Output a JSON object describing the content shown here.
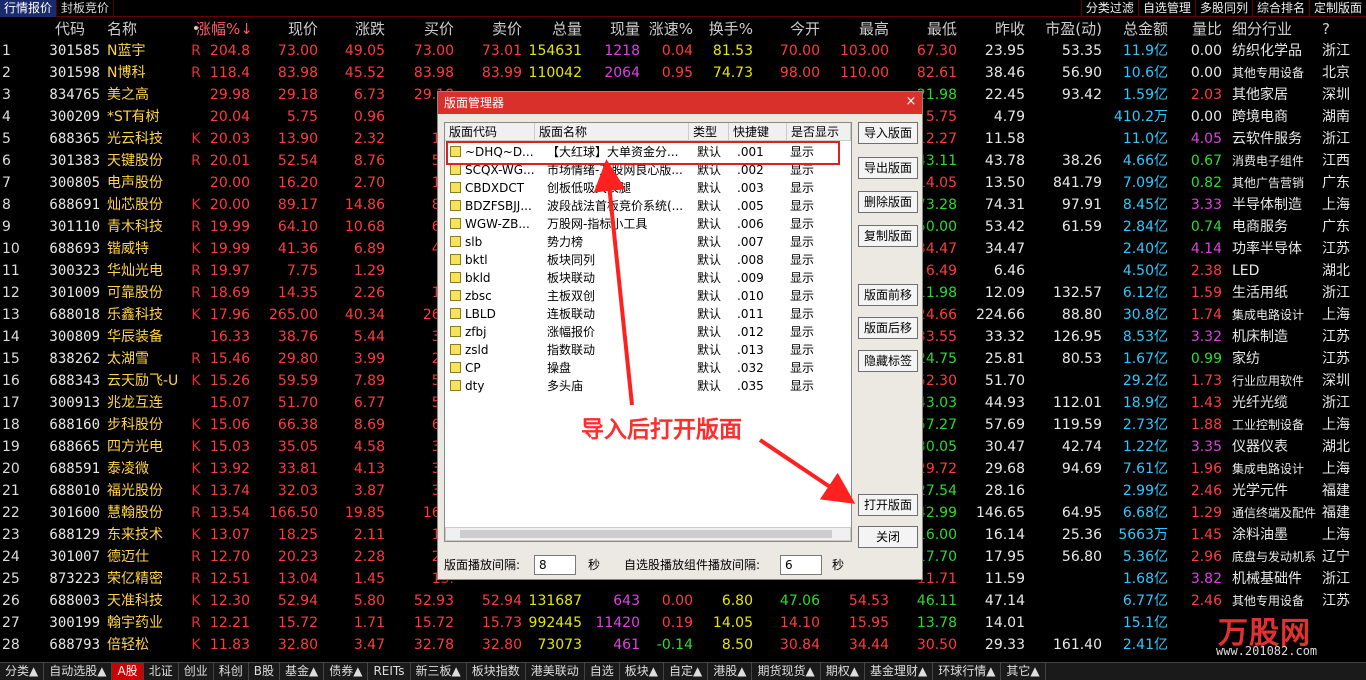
{
  "top_tabs": [
    "行情报价",
    "封板竞价"
  ],
  "top_right": [
    "分类过滤",
    "自选管理",
    "多股同列",
    "综合排名",
    "定制版面"
  ],
  "header": {
    "idx": "",
    "code": "代码",
    "name": "名称",
    "dot": "•",
    "chg": "涨幅%↓",
    "price": "现价",
    "diff": "涨跌",
    "buy": "买价",
    "sell": "卖价",
    "vol": "总量",
    "cur": "现量",
    "spd": "涨速%",
    "turn": "换手%",
    "open": "今开",
    "high": "最高",
    "low": "最低",
    "prev": "昨收",
    "pe": "市盈(动)",
    "amt": "总金额",
    "vr": "量比",
    "ind": "细分行业",
    "reg": "?"
  },
  "rows": [
    {
      "idx": "1",
      "code": "301585",
      "name": "N蓝宇",
      "flag": "R",
      "chg": "204.8",
      "price": "73.00",
      "diff": "49.05",
      "buy": "73.00",
      "sell": "73.01",
      "vol": "154631",
      "cur": "1218",
      "spd": "0.04",
      "turn": "81.53",
      "open": "70.00",
      "high": "103.00",
      "low": "67.30",
      "prev": "23.95",
      "pe": "53.35",
      "amt": "11.9亿",
      "vr": "0.00",
      "ind": "纺织化学品",
      "reg": "浙江"
    },
    {
      "idx": "2",
      "code": "301598",
      "name": "N博科",
      "flag": "R",
      "chg": "118.4",
      "price": "83.98",
      "diff": "45.52",
      "buy": "83.98",
      "sell": "83.99",
      "vol": "110042",
      "cur": "2064",
      "spd": "0.95",
      "turn": "74.73",
      "open": "98.00",
      "high": "110.00",
      "low": "82.61",
      "prev": "38.46",
      "pe": "56.90",
      "amt": "10.6亿",
      "vr": "0.00",
      "ind": "其他专用设备",
      "reg": "北京"
    },
    {
      "idx": "3",
      "code": "834765",
      "name": "美之高",
      "flag": "",
      "chg": "29.98",
      "price": "29.18",
      "diff": "6.73",
      "buy": "29.18",
      "sell": "",
      "vol": "",
      "cur": "",
      "spd": "",
      "turn": "",
      "open": "",
      "high": "",
      "low": "21.98",
      "prev": "22.45",
      "pe": "93.42",
      "amt": "1.59亿",
      "vr": "2.03",
      "ind": "其他家居",
      "reg": "深圳"
    },
    {
      "idx": "4",
      "code": "300209",
      "name": "*ST有树",
      "flag": "",
      "chg": "20.04",
      "price": "5.75",
      "diff": "0.96",
      "buy": "5.",
      "sell": "",
      "vol": "",
      "cur": "",
      "spd": "",
      "turn": "",
      "open": "",
      "high": "",
      "low": "5.75",
      "prev": "4.79",
      "pe": "",
      "amt": "410.2万",
      "vr": "0.00",
      "ind": "跨境电商",
      "reg": "湖南"
    },
    {
      "idx": "5",
      "code": "688365",
      "name": "光云科技",
      "flag": "K",
      "chg": "20.03",
      "price": "13.90",
      "diff": "2.32",
      "buy": "13.",
      "sell": "",
      "vol": "",
      "cur": "",
      "spd": "",
      "turn": "",
      "open": "",
      "high": "",
      "low": "12.27",
      "prev": "11.58",
      "pe": "",
      "amt": "11.0亿",
      "vr": "4.05",
      "ind": "云软件服务",
      "reg": "浙江"
    },
    {
      "idx": "6",
      "code": "301383",
      "name": "天键股份",
      "flag": "R",
      "chg": "20.01",
      "price": "52.54",
      "diff": "8.76",
      "buy": "52.",
      "sell": "",
      "vol": "",
      "cur": "",
      "spd": "",
      "turn": "",
      "open": "",
      "high": "",
      "low": "43.11",
      "prev": "43.78",
      "pe": "38.26",
      "amt": "4.66亿",
      "vr": "0.67",
      "ind": "消费电子组件",
      "reg": "江西"
    },
    {
      "idx": "7",
      "code": "300805",
      "name": "电声股份",
      "flag": "",
      "chg": "20.00",
      "price": "16.20",
      "diff": "2.70",
      "buy": "16.",
      "sell": "",
      "vol": "",
      "cur": "",
      "spd": "",
      "turn": "",
      "open": "",
      "high": "",
      "low": "14.05",
      "prev": "13.50",
      "pe": "841.79",
      "amt": "7.09亿",
      "vr": "0.82",
      "ind": "其他广告营销",
      "reg": "广东"
    },
    {
      "idx": "8",
      "code": "688691",
      "name": "灿芯股份",
      "flag": "K",
      "chg": "20.00",
      "price": "89.17",
      "diff": "14.86",
      "buy": "89.",
      "sell": "",
      "vol": "",
      "cur": "",
      "spd": "",
      "turn": "",
      "open": "",
      "high": "",
      "low": "73.28",
      "prev": "74.31",
      "pe": "97.91",
      "amt": "8.45亿",
      "vr": "3.33",
      "ind": "半导体制造",
      "reg": "上海"
    },
    {
      "idx": "9",
      "code": "301110",
      "name": "青木科技",
      "flag": "R",
      "chg": "19.99",
      "price": "64.10",
      "diff": "10.68",
      "buy": "64.",
      "sell": "",
      "vol": "",
      "cur": "",
      "spd": "",
      "turn": "",
      "open": "",
      "high": "",
      "low": "50.00",
      "prev": "53.42",
      "pe": "61.59",
      "amt": "2.84亿",
      "vr": "0.74",
      "ind": "电商服务",
      "reg": "广东"
    },
    {
      "idx": "10",
      "code": "688693",
      "name": "锴威特",
      "flag": "K",
      "chg": "19.99",
      "price": "41.36",
      "diff": "6.89",
      "buy": "41.",
      "sell": "",
      "vol": "",
      "cur": "",
      "spd": "",
      "turn": "",
      "open": "",
      "high": "",
      "low": "34.47",
      "prev": "34.47",
      "pe": "",
      "amt": "2.40亿",
      "vr": "4.14",
      "ind": "功率半导体",
      "reg": "江苏"
    },
    {
      "idx": "11",
      "code": "300323",
      "name": "华灿光电",
      "flag": "R",
      "chg": "19.97",
      "price": "7.75",
      "diff": "1.29",
      "buy": "7.",
      "sell": "",
      "vol": "",
      "cur": "",
      "spd": "",
      "turn": "",
      "open": "",
      "high": "",
      "low": "6.49",
      "prev": "6.46",
      "pe": "",
      "amt": "4.50亿",
      "vr": "2.38",
      "ind": "LED",
      "reg": "湖北"
    },
    {
      "idx": "12",
      "code": "301009",
      "name": "可靠股份",
      "flag": "R",
      "chg": "18.69",
      "price": "14.35",
      "diff": "2.26",
      "buy": "14.",
      "sell": "",
      "vol": "",
      "cur": "",
      "spd": "",
      "turn": "",
      "open": "",
      "high": "",
      "low": "11.98",
      "prev": "12.09",
      "pe": "132.57",
      "amt": "6.12亿",
      "vr": "1.59",
      "ind": "生活用纸",
      "reg": "浙江"
    },
    {
      "idx": "13",
      "code": "688018",
      "name": "乐鑫科技",
      "flag": "K",
      "chg": "17.96",
      "price": "265.00",
      "diff": "40.34",
      "buy": "265.",
      "sell": "",
      "vol": "",
      "cur": "",
      "spd": "",
      "turn": "",
      "open": "",
      "high": "",
      "low": "224.66",
      "prev": "224.66",
      "pe": "88.80",
      "amt": "30.8亿",
      "vr": "1.74",
      "ind": "集成电路设计",
      "reg": "上海"
    },
    {
      "idx": "14",
      "code": "300809",
      "name": "华辰装备",
      "flag": "",
      "chg": "16.33",
      "price": "38.76",
      "diff": "5.44",
      "buy": "38.",
      "sell": "",
      "vol": "",
      "cur": "",
      "spd": "",
      "turn": "",
      "open": "",
      "high": "",
      "low": "33.55",
      "prev": "33.32",
      "pe": "126.95",
      "amt": "8.53亿",
      "vr": "3.32",
      "ind": "机床制造",
      "reg": "江苏"
    },
    {
      "idx": "15",
      "code": "838262",
      "name": "太湖雪",
      "flag": "R",
      "chg": "15.46",
      "price": "29.80",
      "diff": "3.99",
      "buy": "29.",
      "sell": "",
      "vol": "",
      "cur": "",
      "spd": "",
      "turn": "",
      "open": "",
      "high": "",
      "low": "24.75",
      "prev": "25.81",
      "pe": "80.53",
      "amt": "1.67亿",
      "vr": "0.99",
      "ind": "家纺",
      "reg": "江苏"
    },
    {
      "idx": "16",
      "code": "688343",
      "name": "云天励飞-U",
      "flag": "K",
      "chg": "15.26",
      "price": "59.59",
      "diff": "7.89",
      "buy": "59.",
      "sell": "",
      "vol": "",
      "cur": "",
      "spd": "",
      "turn": "",
      "open": "",
      "high": "",
      "low": "52.30",
      "prev": "51.70",
      "pe": "",
      "amt": "29.2亿",
      "vr": "1.73",
      "ind": "行业应用软件",
      "reg": "深圳"
    },
    {
      "idx": "17",
      "code": "300913",
      "name": "兆龙互连",
      "flag": "",
      "chg": "15.07",
      "price": "51.70",
      "diff": "6.77",
      "buy": "51.",
      "sell": "",
      "vol": "",
      "cur": "",
      "spd": "",
      "turn": "",
      "open": "",
      "high": "",
      "low": "43.03",
      "prev": "44.93",
      "pe": "112.01",
      "amt": "18.9亿",
      "vr": "1.43",
      "ind": "光纤光缆",
      "reg": "浙江"
    },
    {
      "idx": "18",
      "code": "688160",
      "name": "步科股份",
      "flag": "K",
      "chg": "15.06",
      "price": "66.38",
      "diff": "8.69",
      "buy": "66.",
      "sell": "",
      "vol": "",
      "cur": "",
      "spd": "",
      "turn": "",
      "open": "",
      "high": "",
      "low": "57.27",
      "prev": "57.69",
      "pe": "119.59",
      "amt": "2.73亿",
      "vr": "1.88",
      "ind": "工业控制设备",
      "reg": "上海"
    },
    {
      "idx": "19",
      "code": "688665",
      "name": "四方光电",
      "flag": "K",
      "chg": "15.03",
      "price": "35.05",
      "diff": "4.58",
      "buy": "35.",
      "sell": "",
      "vol": "",
      "cur": "",
      "spd": "",
      "turn": "",
      "open": "",
      "high": "",
      "low": "30.05",
      "prev": "30.47",
      "pe": "42.74",
      "amt": "1.22亿",
      "vr": "3.35",
      "ind": "仪器仪表",
      "reg": "湖北"
    },
    {
      "idx": "20",
      "code": "688591",
      "name": "泰凌微",
      "flag": "K",
      "chg": "13.92",
      "price": "33.81",
      "diff": "4.13",
      "buy": "33.",
      "sell": "",
      "vol": "",
      "cur": "",
      "spd": "",
      "turn": "",
      "open": "",
      "high": "",
      "low": "29.72",
      "prev": "29.68",
      "pe": "94.69",
      "amt": "7.61亿",
      "vr": "1.96",
      "ind": "集成电路设计",
      "reg": "上海"
    },
    {
      "idx": "21",
      "code": "688010",
      "name": "福光股份",
      "flag": "K",
      "chg": "13.74",
      "price": "32.03",
      "diff": "3.87",
      "buy": "32.",
      "sell": "",
      "vol": "",
      "cur": "",
      "spd": "",
      "turn": "",
      "open": "",
      "high": "",
      "low": "27.54",
      "prev": "28.16",
      "pe": "",
      "amt": "2.99亿",
      "vr": "2.46",
      "ind": "光学元件",
      "reg": "福建"
    },
    {
      "idx": "22",
      "code": "301600",
      "name": "慧翰股份",
      "flag": "R",
      "chg": "13.54",
      "price": "166.50",
      "diff": "19.85",
      "buy": "166.",
      "sell": "",
      "vol": "",
      "cur": "",
      "spd": "",
      "turn": "",
      "open": "",
      "high": "",
      "low": "142.99",
      "prev": "146.65",
      "pe": "64.95",
      "amt": "6.68亿",
      "vr": "1.29",
      "ind": "通信终端及配件",
      "reg": "福建"
    },
    {
      "idx": "23",
      "code": "688129",
      "name": "东来技术",
      "flag": "K",
      "chg": "13.07",
      "price": "18.25",
      "diff": "2.11",
      "buy": "18.",
      "sell": "",
      "vol": "",
      "cur": "",
      "spd": "",
      "turn": "",
      "open": "",
      "high": "",
      "low": "16.00",
      "prev": "16.14",
      "pe": "25.36",
      "amt": "5663万",
      "vr": "1.45",
      "ind": "涂料油墨",
      "reg": "上海"
    },
    {
      "idx": "24",
      "code": "301007",
      "name": "德迈仕",
      "flag": "R",
      "chg": "12.70",
      "price": "20.23",
      "diff": "2.28",
      "buy": "20.",
      "sell": "",
      "vol": "",
      "cur": "",
      "spd": "",
      "turn": "",
      "open": "",
      "high": "",
      "low": "17.70",
      "prev": "17.95",
      "pe": "56.80",
      "amt": "5.36亿",
      "vr": "2.96",
      "ind": "底盘与发动机系",
      "reg": "辽宁"
    },
    {
      "idx": "25",
      "code": "873223",
      "name": "荣亿精密",
      "flag": "R",
      "chg": "12.51",
      "price": "13.04",
      "diff": "1.45",
      "buy": "13.",
      "sell": "",
      "vol": "",
      "cur": "",
      "spd": "",
      "turn": "",
      "open": "",
      "high": "",
      "low": "11.71",
      "prev": "11.59",
      "pe": "",
      "amt": "1.68亿",
      "vr": "3.82",
      "ind": "机械基础件",
      "reg": "浙江"
    },
    {
      "idx": "26",
      "code": "688003",
      "name": "天准科技",
      "flag": "K",
      "chg": "12.30",
      "price": "52.94",
      "diff": "5.80",
      "buy": "52.93",
      "sell": "52.94",
      "vol": "131687",
      "cur": "643",
      "spd": "0.00",
      "turn": "6.80",
      "open": "47.06",
      "high": "54.53",
      "low": "46.11",
      "prev": "47.14",
      "pe": "",
      "amt": "6.77亿",
      "vr": "2.46",
      "ind": "其他专用设备",
      "reg": "江苏"
    },
    {
      "idx": "27",
      "code": "300199",
      "name": "翰宇药业",
      "flag": "R",
      "chg": "12.21",
      "price": "15.72",
      "diff": "1.71",
      "buy": "15.72",
      "sell": "15.73",
      "vol": "992445",
      "cur": "11420",
      "spd": "0.19",
      "turn": "14.05",
      "open": "14.10",
      "high": "15.95",
      "low": "13.78",
      "prev": "14.01",
      "pe": "",
      "amt": "15.1亿",
      "vr": "",
      "ind": "",
      "reg": ""
    },
    {
      "idx": "28",
      "code": "688793",
      "name": "倍轻松",
      "flag": "K",
      "chg": "11.83",
      "price": "32.80",
      "diff": "3.47",
      "buy": "32.78",
      "sell": "32.80",
      "vol": "73073",
      "cur": "461",
      "spd": "-0.14",
      "turn": "8.50",
      "open": "30.84",
      "high": "34.44",
      "low": "30.50",
      "prev": "29.33",
      "pe": "161.40",
      "amt": "2.41亿",
      "vr": "",
      "ind": "",
      "reg": ""
    }
  ],
  "bottom_tabs": [
    "分类▲",
    "自动选股▲",
    "A股",
    "北证",
    "创业",
    "科创",
    "B股",
    "基金▲",
    "债券▲",
    "REITs",
    "新三板▲",
    "板块指数",
    "港美联动",
    "自选",
    "板块▲",
    "自定▲",
    "港股▲",
    "期货现货▲",
    "期权▲",
    "基金理财▲",
    "环球行情▲",
    "其它▲"
  ],
  "dialog": {
    "title": "版面管理器",
    "close": "×",
    "columns": {
      "code": "版面代码",
      "name": "版面名称",
      "type": "类型",
      "key": "快捷键",
      "show": "是否显示"
    },
    "items": [
      {
        "code": "~DHQ~D...",
        "name": "【大红球】大单资金分...",
        "type": "默认",
        "key": ".001",
        "show": "显示"
      },
      {
        "code": "SCQX-WG...",
        "name": "市场情绪-万股网良心版...",
        "type": "默认",
        "key": ".002",
        "show": "显示"
      },
      {
        "code": "CBDXDCT",
        "name": "创板低吸大长腿",
        "type": "默认",
        "key": ".003",
        "show": "显示"
      },
      {
        "code": "BDZFSBJJ...",
        "name": "波段战法首板竞价系统(...",
        "type": "默认",
        "key": ".005",
        "show": "显示"
      },
      {
        "code": "WGW-ZB...",
        "name": "万股网-指标小工具",
        "type": "默认",
        "key": ".006",
        "show": "显示"
      },
      {
        "code": "slb",
        "name": "势力榜",
        "type": "默认",
        "key": ".007",
        "show": "显示"
      },
      {
        "code": "bktl",
        "name": "板块同列",
        "type": "默认",
        "key": ".008",
        "show": "显示"
      },
      {
        "code": "bkld",
        "name": "板块联动",
        "type": "默认",
        "key": ".009",
        "show": "显示"
      },
      {
        "code": "zbsc",
        "name": "主板双创",
        "type": "默认",
        "key": ".010",
        "show": "显示"
      },
      {
        "code": "LBLD",
        "name": "连板联动",
        "type": "默认",
        "key": ".011",
        "show": "显示"
      },
      {
        "code": "zfbj",
        "name": "涨幅报价",
        "type": "默认",
        "key": ".012",
        "show": "显示"
      },
      {
        "code": "zsld",
        "name": "指数联动",
        "type": "默认",
        "key": ".013",
        "show": "显示"
      },
      {
        "code": "CP",
        "name": "操盘",
        "type": "默认",
        "key": ".032",
        "show": "显示"
      },
      {
        "code": "dty",
        "name": "多头庙",
        "type": "默认",
        "key": ".035",
        "show": "显示"
      }
    ],
    "buttons": {
      "import": "导入版面",
      "export": "导出版面",
      "delete": "删除版面",
      "copy": "复制版面",
      "move_up": "版面前移",
      "move_down": "版面后移",
      "hide_tab": "隐藏标签",
      "open": "打开版面",
      "close_btn": "关闭"
    },
    "interval_label": "版面播放间隔:",
    "interval_value": "8",
    "interval_unit": "秒",
    "watch_label": "自选股播放组件播放间隔:",
    "watch_value": "6",
    "watch_unit": "秒"
  },
  "annotation": "导入后打开版面",
  "logo": {
    "text": "万股网",
    "url": "www.201082.com"
  }
}
